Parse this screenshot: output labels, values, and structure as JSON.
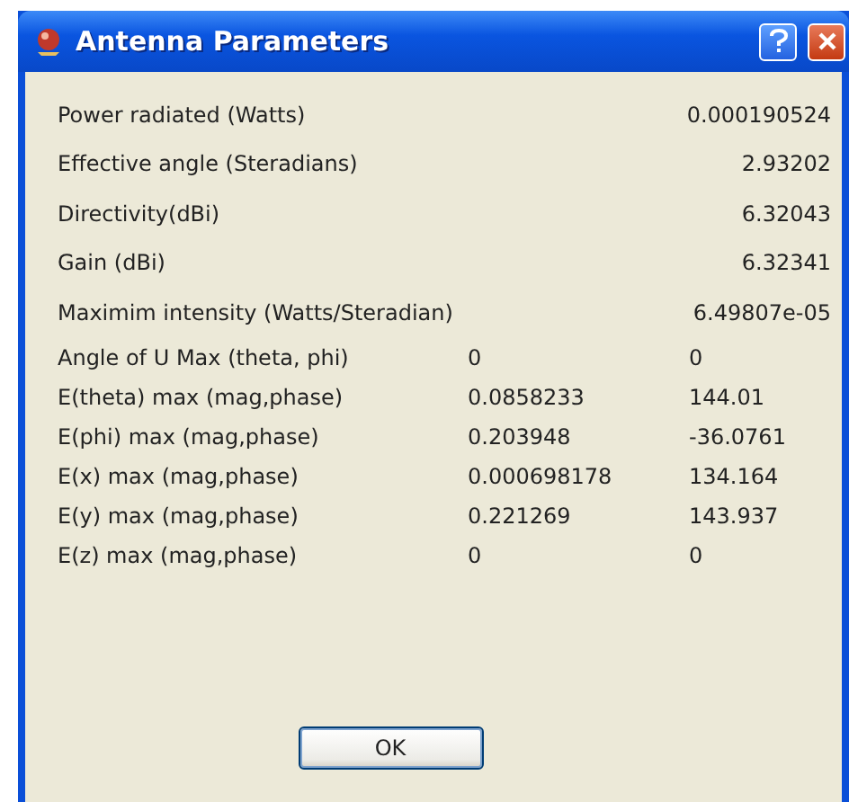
{
  "window": {
    "title": "Antenna Parameters"
  },
  "rows": [
    {
      "kind": "single",
      "label": "Power radiated (Watts)",
      "value": "0.000190524"
    },
    {
      "kind": "single",
      "label": "Effective angle (Steradians)",
      "value": "2.93202"
    },
    {
      "kind": "single",
      "label": "Directivity(dBi)",
      "value": "6.32043"
    },
    {
      "kind": "single",
      "label": "Gain (dBi)",
      "value": "6.32341"
    },
    {
      "kind": "single",
      "label": "Maximim intensity (Watts/Steradian)",
      "value": "6.49807e-05"
    },
    {
      "kind": "pair",
      "label": "Angle of U Max (theta, phi)",
      "value_1": "0",
      "value_2": "0"
    },
    {
      "kind": "pair",
      "label": "E(theta) max (mag,phase)",
      "value_1": "0.0858233",
      "value_2": "144.01"
    },
    {
      "kind": "pair",
      "label": "E(phi) max (mag,phase)",
      "value_1": "0.203948",
      "value_2": "-36.0761"
    },
    {
      "kind": "pair",
      "label": "E(x) max (mag,phase)",
      "value_1": "0.000698178",
      "value_2": "134.164"
    },
    {
      "kind": "pair",
      "label": "E(y) max (mag,phase)",
      "value_1": "0.221269",
      "value_2": "143.937"
    },
    {
      "kind": "pair",
      "label": "E(z) max (mag,phase)",
      "value_1": "0",
      "value_2": "0"
    }
  ],
  "buttons": [
    "OK"
  ]
}
